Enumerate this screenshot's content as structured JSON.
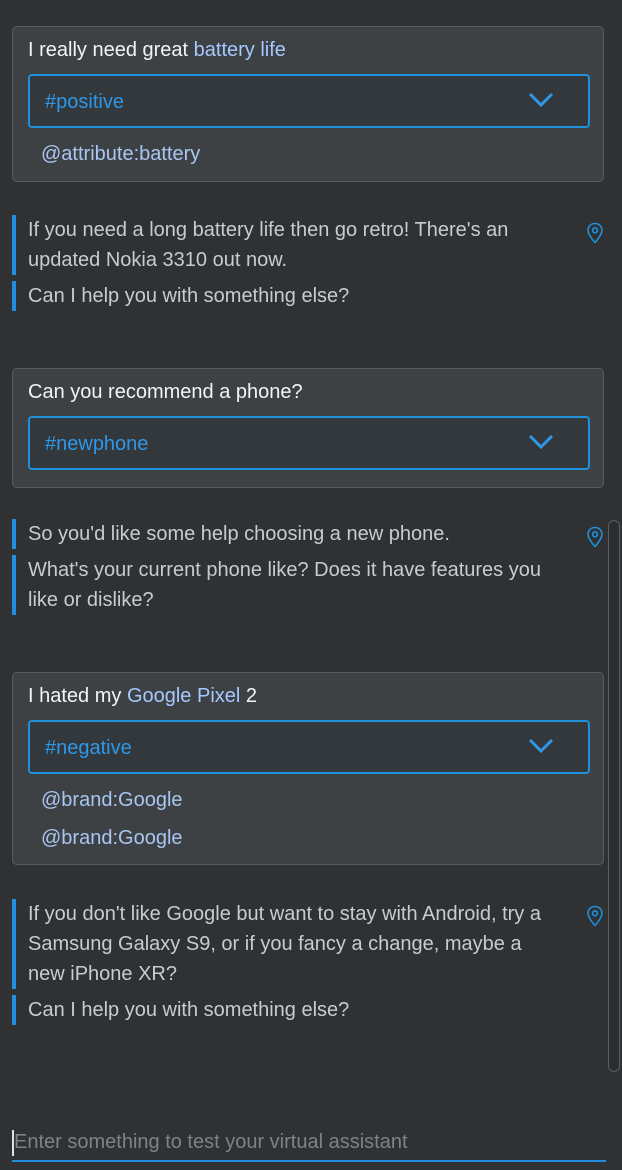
{
  "conversation": [
    {
      "user": {
        "prefix": "I really need great ",
        "entity": "battery life",
        "suffix": ""
      },
      "intent": "#positive",
      "attributes": [
        "@attribute:battery"
      ],
      "responses": [
        "If you need a long battery life then go retro! There's an updated Nokia 3310 out now.",
        "Can I help you with something else?"
      ]
    },
    {
      "user": {
        "prefix": "Can you recommend a phone?",
        "entity": "",
        "suffix": ""
      },
      "intent": "#newphone",
      "attributes": [],
      "responses": [
        "So you'd like some help choosing a new phone.",
        "What's your current phone like? Does it have features you like or dislike?"
      ]
    },
    {
      "user": {
        "prefix": "I hated my ",
        "entity": "Google Pixel",
        "suffix": " 2"
      },
      "intent": "#negative",
      "attributes": [
        "@brand:Google",
        "@brand:Google"
      ],
      "responses": [
        "If you don't like Google but want to stay with Android, try a Samsung Galaxy S9, or if you fancy a change, maybe a new iPhone XR?",
        "Can I help you with something else?"
      ]
    }
  ],
  "input": {
    "placeholder": "Enter something to test your virtual assistant"
  },
  "icons": {
    "intent_dropdown": "chevron-down-icon",
    "response_marker": "location-pin-icon"
  },
  "colors": {
    "accent": "#1f90de",
    "entity": "#a6c8ff",
    "background": "#2f3132",
    "card": "#3d4144"
  }
}
